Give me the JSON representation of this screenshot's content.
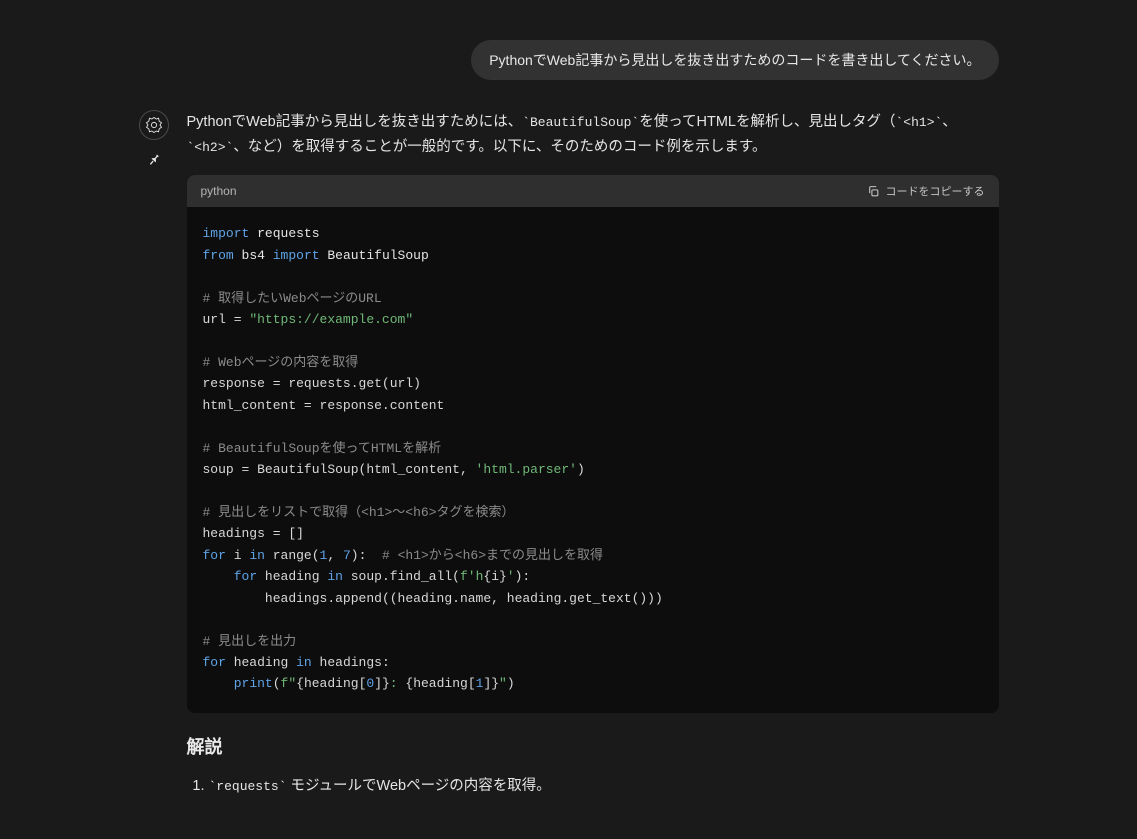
{
  "user": {
    "message": "PythonでWeb記事から見出しを抜き出すためのコードを書き出してください。"
  },
  "assistant": {
    "intro_pre": "PythonでWeb記事から見出しを抜き出すためには、",
    "intro_lib": "`BeautifulSoup`",
    "intro_mid": "を使ってHTMLを解析し、見出しタグ（",
    "intro_h1": "`<h1>`",
    "intro_sep": "、",
    "intro_h2": "`<h2>`",
    "intro_post": "、など）を取得することが一般的です。以下に、そのためのコード例を示します。"
  },
  "code": {
    "lang": "python",
    "copy_label": "コードをコピーする",
    "l1_import": "import",
    "l1_requests": " requests",
    "l2_from": "from",
    "l2_bs4": " bs4 ",
    "l2_import": "import",
    "l2_bsoup": " BeautifulSoup",
    "c1": "# 取得したいWebページのURL",
    "l3_a": "url = ",
    "l3_b": "\"https://example.com\"",
    "c2": "# Webページの内容を取得",
    "l4": "response = requests.get(url)",
    "l5": "html_content = response.content",
    "c3": "# BeautifulSoupを使ってHTMLを解析",
    "l6_a": "soup = BeautifulSoup(html_content, ",
    "l6_b": "'html.parser'",
    "l6_c": ")",
    "c4": "# 見出しをリストで取得（<h1>〜<h6>タグを検索）",
    "l7": "headings = []",
    "l8_for": "for",
    "l8_i": " i ",
    "l8_in": "in",
    "l8_range": " range(",
    "l8_n1": "1",
    "l8_comma": ", ",
    "l8_n7": "7",
    "l8_close": "):  ",
    "l8_cm": "# <h1>から<h6>までの見出しを取得",
    "l9_indent": "    ",
    "l9_for": "for",
    "l9_h": " heading ",
    "l9_in": "in",
    "l9_find": " soup.find_all(",
    "l9_f": "f'h",
    "l9_br1": "{i}",
    "l9_f2": "'",
    "l9_close": "):",
    "l10_indent": "        ",
    "l10": "headings.append((heading.name, heading.get_text()))",
    "c5": "# 見出しを出力",
    "l11_for": "for",
    "l11_h": " heading ",
    "l11_in": "in",
    "l11_hs": " headings:",
    "l12_indent": "    ",
    "l12_print": "print",
    "l12_open": "(",
    "l12_f": "f\"",
    "l12_br1a": "{heading[",
    "l12_i0": "0",
    "l12_br1b": "]}",
    "l12_colon": ": ",
    "l12_br2a": "{heading[",
    "l12_i1": "1",
    "l12_br2b": "]}",
    "l12_fend": "\"",
    "l12_close": ")"
  },
  "explain": {
    "heading": "解説",
    "item1_pre": "",
    "item1_code": "`requests`",
    "item1_post": " モジュールでWebページの内容を取得。"
  }
}
